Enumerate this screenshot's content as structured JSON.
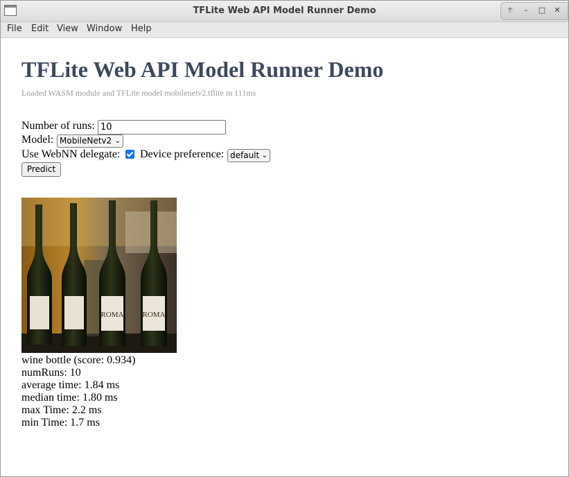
{
  "window": {
    "title": "TFLite Web API Model Runner Demo"
  },
  "menu": [
    "File",
    "Edit",
    "View",
    "Window",
    "Help"
  ],
  "page": {
    "heading": "TFLite Web API Model Runner Demo",
    "status": "Loaded WASM module and TFLite model mobilenetv2.tflite in 111ms"
  },
  "form": {
    "runs_label": "Number of runs:",
    "runs_value": "10",
    "model_label": "Model:",
    "model_value": "MobileNetv2",
    "webnn_label": "Use WebNN delegate:",
    "webnn_checked": true,
    "device_label": "Device preference:",
    "device_value": "default",
    "predict_label": "Predict"
  },
  "results": {
    "prediction": "wine bottle (score: 0.934)",
    "num_runs": "numRuns: 10",
    "average": "average time: 1.84 ms",
    "median": "median time: 1.80 ms",
    "max": "max Time: 2.2 ms",
    "min": "min Time: 1.7 ms"
  },
  "photo_labels": [
    "ROMA",
    "ROMA"
  ]
}
